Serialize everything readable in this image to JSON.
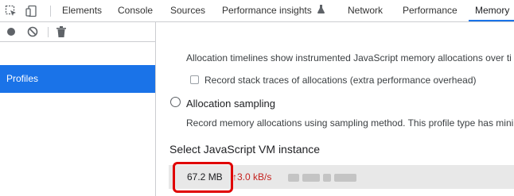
{
  "tabs": [
    "Elements",
    "Console",
    "Sources",
    "Performance insights",
    "Network",
    "Performance",
    "Memory"
  ],
  "active_tab": "Memory",
  "sidebar": {
    "profiles_label": "Profiles"
  },
  "content": {
    "alloc_timeline_desc": "Allocation timelines show instrumented JavaScript memory allocations over ti",
    "record_stack_label": "Record stack traces of allocations (extra performance overhead)",
    "alloc_sampling_label": "Allocation sampling",
    "alloc_sampling_desc": "Record memory allocations using sampling method. This profile type has mini",
    "vm_heading": "Select JavaScript VM instance",
    "vm_instance": {
      "size": "67.2 MB",
      "rate": "↑3.0 kB/s"
    }
  },
  "colors": {
    "accent": "#1a73e8",
    "rate_red": "#c5221f",
    "highlight": "#e00000"
  }
}
